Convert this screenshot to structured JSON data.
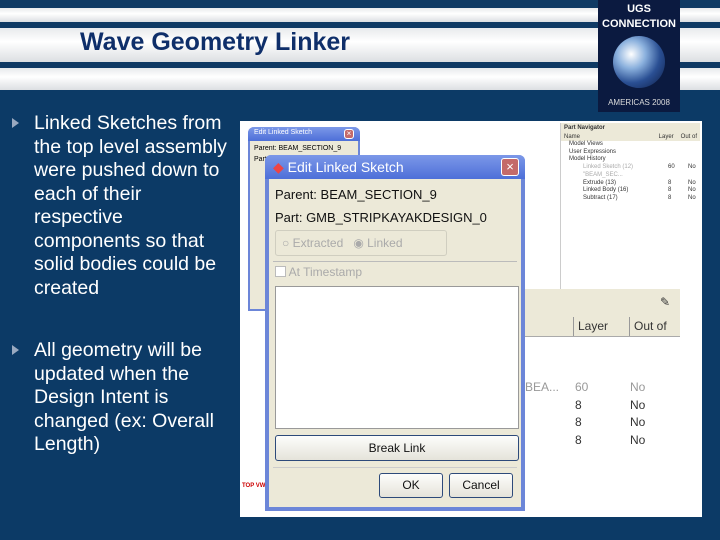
{
  "slide": {
    "title": "Wave Geometry Linker",
    "bullets": [
      "Linked Sketches from the top level assembly were pushed down to each of their respective components so that solid bodies could be created",
      "All geometry will be updated when the Design Intent is changed (ex: Overall Length)"
    ]
  },
  "logo": {
    "line1": "UGS",
    "line2": "CONNECTION",
    "line3": "AMERICAS 2008"
  },
  "navigator": {
    "title": "Part Navigator",
    "col_name": "Name",
    "col_layer": "Layer",
    "col_out": "Out of",
    "items": [
      "Model Views",
      "User Expressions",
      "Model History",
      "Linked Sketch (12) \"BEAM_SEC...",
      "Extrude (13)",
      "Linked Body (16)",
      "Subtract (17)"
    ],
    "layers": [
      "60",
      "8",
      "8",
      "8"
    ],
    "outs": [
      "No",
      "No",
      "No",
      "No"
    ]
  },
  "nav2": {
    "col_layer": "Layer",
    "col_out": "Out of",
    "trunc": "BEA...",
    "layers": [
      "60",
      "8",
      "8",
      "8"
    ],
    "outs": [
      "No",
      "No",
      "No",
      "No"
    ]
  },
  "back_dialog": {
    "title": "Edit Linked Sketch",
    "parent": "Parent: BEAM_SECTION_9",
    "part": "Part"
  },
  "dialog": {
    "title": "Edit Linked Sketch",
    "parent": "Parent: BEAM_SECTION_9",
    "part": "Part: GMB_STRIPKAYAKDESIGN_0",
    "radio_extracted": "Extracted",
    "radio_linked": "Linked",
    "checkbox": "At Timestamp",
    "break_link": "Break Link",
    "ok": "OK",
    "cancel": "Cancel"
  },
  "footer_text": "TOP VW"
}
